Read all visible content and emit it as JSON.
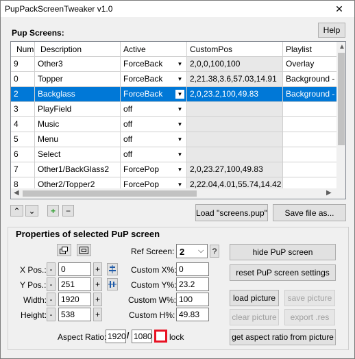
{
  "window": {
    "title": "PupPackScreenTweaker v1.0",
    "close_glyph": "✕"
  },
  "help_label": "Help",
  "screens_label": "Pup Screens:",
  "grid": {
    "columns": [
      "Num",
      "Description",
      "Active",
      "CustomPos",
      "Playlist"
    ],
    "rows": [
      {
        "num": "9",
        "desc": "Other3",
        "active": "ForceBack",
        "pos": "2,0,0,100,100",
        "playlist": "Overlay"
      },
      {
        "num": "0",
        "desc": "Topper",
        "active": "ForceBack",
        "pos": "2,21.38,3.6,57.03,14.91",
        "playlist": "Background - T"
      },
      {
        "num": "2",
        "desc": "Backglass",
        "active": "ForceBack",
        "pos": "2,0,23.2,100,49.83",
        "playlist": "Background - B"
      },
      {
        "num": "3",
        "desc": "PlayField",
        "active": "off",
        "pos": "",
        "playlist": ""
      },
      {
        "num": "4",
        "desc": "Music",
        "active": "off",
        "pos": "",
        "playlist": ""
      },
      {
        "num": "5",
        "desc": "Menu",
        "active": "off",
        "pos": "",
        "playlist": ""
      },
      {
        "num": "6",
        "desc": "Select",
        "active": "off",
        "pos": "",
        "playlist": ""
      },
      {
        "num": "7",
        "desc": "Other1/BackGlass2",
        "active": "ForcePop",
        "pos": "2,0,23.27,100,49.83",
        "playlist": ""
      },
      {
        "num": "8",
        "desc": "Other2/Topper2",
        "active": "ForcePop",
        "pos": "2,22.04,4.01,55.74,14.42",
        "playlist": ""
      }
    ]
  },
  "nav": {
    "up": "⌃",
    "down": "⌄",
    "add": "+",
    "remove": "−"
  },
  "load_button": "Load \"screens.pup\"",
  "save_button": "Save file as...",
  "props": {
    "title": "Properties of selected PuP screen",
    "xpos_label": "X Pos.:",
    "xpos": "0",
    "ypos_label": "Y Pos.:",
    "ypos": "251",
    "width_label": "Width:",
    "width": "1920",
    "height_label": "Height:",
    "height": "538",
    "minus": "-",
    "plus": "+",
    "ref_label": "Ref Screen:",
    "ref_value": "2",
    "ref_q": "?",
    "cx_label": "Custom X%:",
    "cx": "0",
    "cy_label": "Custom Y%:",
    "cy": "23.2",
    "cw_label": "Custom W%:",
    "cw": "100",
    "ch_label": "Custom H%:",
    "ch": "49.83",
    "aspect_label": "Aspect Ratio:",
    "aspect_w": "1920",
    "aspect_sep": "/",
    "aspect_h": "1080",
    "lock_label": "lock",
    "hide_button": "hide PuP screen",
    "reset_button": "reset PuP screen settings",
    "load_pic": "load picture",
    "save_pic": "save picture",
    "clear_pic": "clear picture",
    "export_res": "export .res",
    "aspect_button": "get aspect ratio from picture"
  },
  "colors": {
    "selection": "#0078d7",
    "lock_border": "#e81123"
  }
}
